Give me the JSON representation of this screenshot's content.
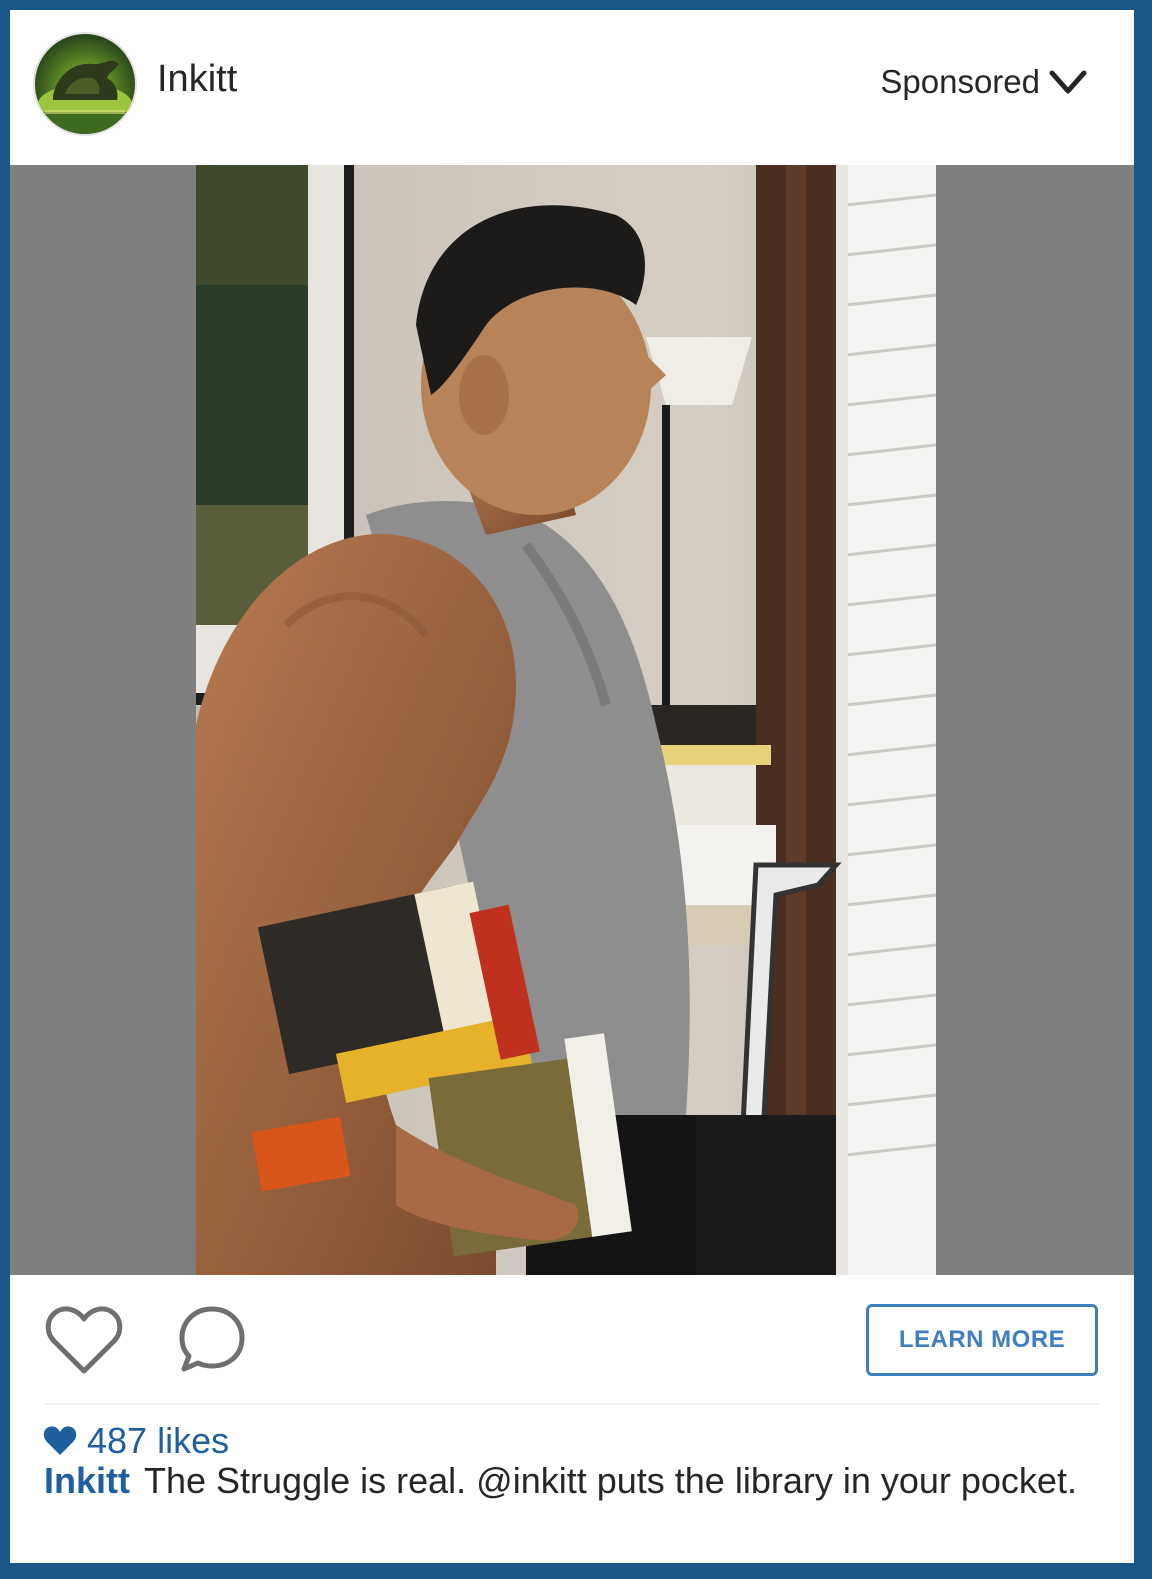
{
  "post": {
    "account_name": "Inkitt",
    "sponsored_label": "Sponsored",
    "cta_label": "LEARN MORE",
    "likes_count": "487",
    "likes_label": "likes",
    "caption_user": "Inkitt",
    "caption_text": "The Struggle is real. @inkitt puts the library in your pocket."
  },
  "icons": {
    "avatar": "inkitt-logo-avatar",
    "sponsored_menu": "chevron-down-icon",
    "like": "heart-outline-icon",
    "comment": "comment-bubble-icon",
    "likes": "heart-filled-icon"
  },
  "colors": {
    "frame": "#1b5689",
    "accent": "#1f5fa0",
    "cta_border": "#3f7fc1",
    "media_background": "#7f7f7f"
  }
}
